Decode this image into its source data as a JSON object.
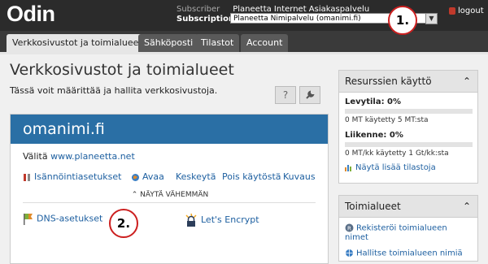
{
  "header": {
    "logo": "Odin",
    "subscriber_label": "Subscriber",
    "subscriber_value": "Planeetta Internet Asiakaspalvelu",
    "subscription_label": "Subscription",
    "subscription_value": "Planeetta Nimipalvelu (omanimi.fi)",
    "logout": "logout"
  },
  "tabs": [
    {
      "label": "Verkkosivustot ja toimialueet",
      "active": true
    },
    {
      "label": "Sähköposti",
      "active": false
    },
    {
      "label": "Tilastot",
      "active": false
    },
    {
      "label": "Account",
      "active": false
    }
  ],
  "main": {
    "title": "Verkkosivustot ja toimialueet",
    "description": "Tässä voit määrittää ja hallita verkkosivustoja.",
    "help_icon": "?"
  },
  "site": {
    "name": "omanimi.fi",
    "visit_label": "Välitä",
    "visit_link": "www.planeetta.net",
    "actions": [
      "Isännöintiasetukset",
      "Avaa",
      "Keskeytä",
      "Pois käytöstä",
      "Kuvaus"
    ],
    "collapse_label": "NÄYTÄ VÄHEMMÄN",
    "dns_label": "DNS-asetukset",
    "letsencrypt_label": "Let's Encrypt"
  },
  "annotations": [
    "1.",
    "2."
  ],
  "resources": {
    "title": "Resurssien käyttö",
    "disk_label": "Levytila: 0%",
    "disk_percent": 0,
    "disk_detail": "0 MT käytetty 5 MT:sta",
    "traffic_label": "Liikenne: 0%",
    "traffic_percent": 0,
    "traffic_detail": "0 MT/kk käytetty 1 Gt/kk:sta",
    "more_stats": "Näytä lisää tilastoja"
  },
  "domains_panel": {
    "title": "Toimialueet",
    "items": [
      "Rekisteröi toimialueen nimet",
      "Hallitse toimialueen nimiä"
    ]
  },
  "colors": {
    "header_bg": "#2b2b2b",
    "accent_blue": "#2a6fa5",
    "link": "#1d5fa0",
    "annotation_red": "#cc1f1f"
  }
}
